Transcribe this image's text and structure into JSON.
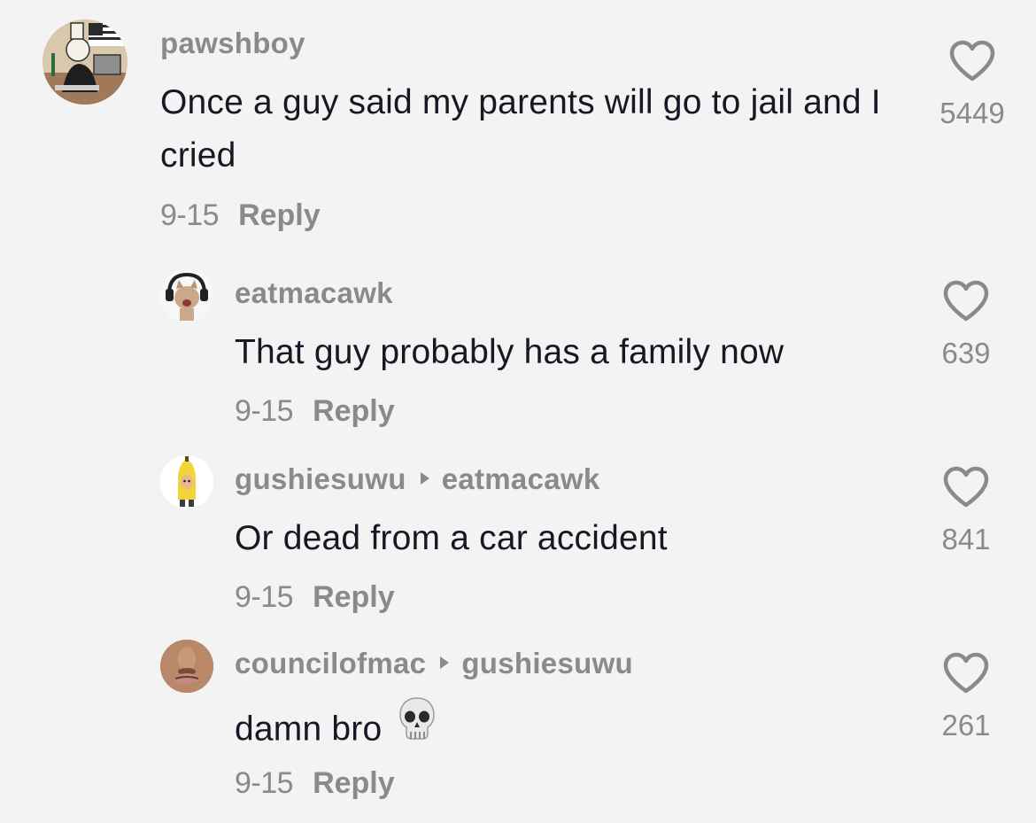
{
  "comments": [
    {
      "username": "pawshboy",
      "reply_to": "",
      "text": "Once a guy said my parents will go to jail and I cried",
      "date": "9-15",
      "reply_label": "Reply",
      "likes": "5449"
    },
    {
      "username": "eatmacawk",
      "reply_to": "",
      "text": "That guy probably has a family now",
      "date": "9-15",
      "reply_label": "Reply",
      "likes": "639"
    },
    {
      "username": "gushiesuwu",
      "reply_to": "eatmacawk",
      "text": "Or dead from a car accident",
      "date": "9-15",
      "reply_label": "Reply",
      "likes": "841"
    },
    {
      "username": "councilofmac",
      "reply_to": "gushiesuwu",
      "text": "damn bro",
      "emoji_icon": "skull-icon",
      "date": "9-15",
      "reply_label": "Reply",
      "likes": "261"
    }
  ],
  "colors": {
    "background": "#f3f3f3",
    "text": "#161823",
    "secondary": "#8a8a8c"
  }
}
